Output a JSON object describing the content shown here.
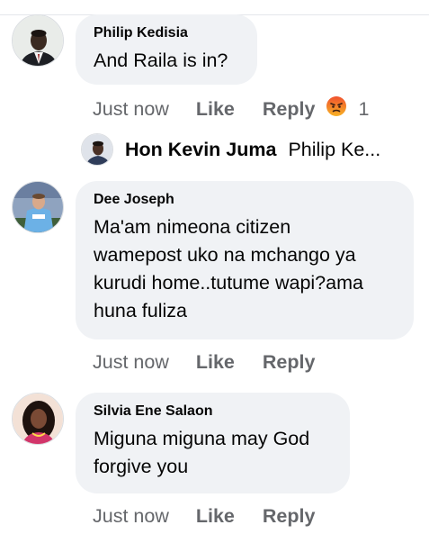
{
  "comments": [
    {
      "author": "Philip Kedisia",
      "lines": [
        "And Raila is in?"
      ],
      "time": "Just now",
      "like_label": "Like",
      "reply_label": "Reply",
      "reaction": {
        "icon": "angry-reaction-icon",
        "count": "1",
        "color": "#f0512e"
      },
      "reply_preview": {
        "author": "Hon Kevin Juma",
        "text": "Philip Ke..."
      }
    },
    {
      "author": "Dee Joseph",
      "lines": [
        "Ma'am nimeona citizen",
        "wamepost uko na mchango ya",
        "kurudi home..tutume wapi?ama",
        "huna fuliza"
      ],
      "time": "Just now",
      "like_label": "Like",
      "reply_label": "Reply"
    },
    {
      "author": "Silvia Ene Salaon",
      "lines": [
        "Miguna miguna may God",
        "forgive you"
      ],
      "time": "Just now",
      "like_label": "Like",
      "reply_label": "Reply"
    }
  ]
}
